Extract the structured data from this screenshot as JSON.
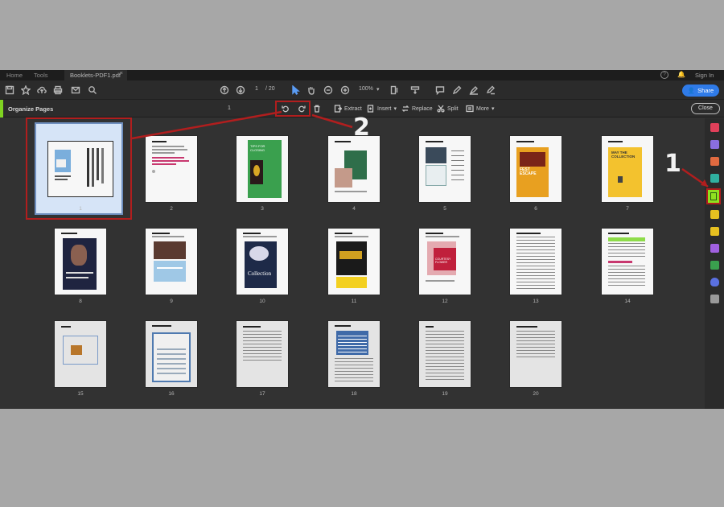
{
  "tabs": {
    "home": "Home",
    "tools": "Tools",
    "document": "Booklets-PDF1.pdf",
    "close": "×"
  },
  "header": {
    "sign_in": "Sign In",
    "share": "Share"
  },
  "toolbar": {
    "page_current": "1",
    "page_total": "/ 20",
    "zoom": "100%"
  },
  "organize": {
    "title": "Organize Pages",
    "selected_count": "1",
    "extract": "Extract",
    "insert": "Insert",
    "replace": "Replace",
    "split": "Split",
    "more": "More",
    "close": "Close"
  },
  "pages": [
    {
      "num": "1"
    },
    {
      "num": "2"
    },
    {
      "num": "3"
    },
    {
      "num": "4"
    },
    {
      "num": "5"
    },
    {
      "num": "6"
    },
    {
      "num": "7"
    },
    {
      "num": "8"
    },
    {
      "num": "9"
    },
    {
      "num": "10"
    },
    {
      "num": "11"
    },
    {
      "num": "12"
    },
    {
      "num": "13"
    },
    {
      "num": "14"
    },
    {
      "num": "15"
    },
    {
      "num": "16"
    },
    {
      "num": "17"
    },
    {
      "num": "18"
    },
    {
      "num": "19"
    },
    {
      "num": "20"
    }
  ],
  "thumb_text": {
    "p3": "TIPS FOR CLOSING",
    "p6": "FEST ESCAPE",
    "p7": "MAY THE COLLECTION",
    "p10": "Collection",
    "p12": "COURTESY FLOWER"
  },
  "annotations": {
    "one": "1",
    "two": "2"
  },
  "colors": {
    "accent_green": "#7fd321",
    "share_blue": "#2f7be8",
    "highlight_red": "#b11e1e"
  }
}
